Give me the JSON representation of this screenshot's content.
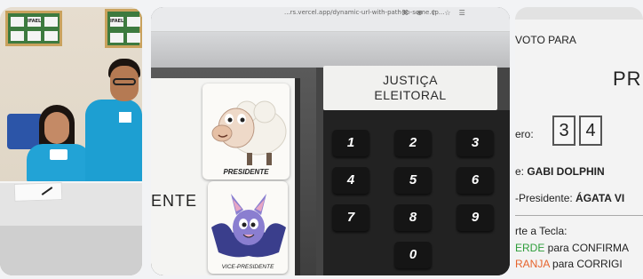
{
  "photo": {
    "board_labels": [
      "IFAEL",
      "IFAEL"
    ]
  },
  "browser": {
    "url_text": "...rs.vercel.app/dynamic-url-with-path-to-some.cp...",
    "icons": [
      "extension-icon",
      "zoom-icon",
      "share-icon",
      "star-icon",
      "menu-icon"
    ]
  },
  "machine": {
    "screen_label": "ENTE",
    "card_president_caption": "PRESIDENTE",
    "card_vice_caption": "VICE-PRESIDENTE",
    "title_line1": "JUSTIÇA",
    "title_line2": "ELEITORAL",
    "keys": [
      "1",
      "2",
      "3",
      "4",
      "5",
      "6",
      "7",
      "8",
      "9",
      "0"
    ]
  },
  "confirm": {
    "voto_para": "VOTO PARA",
    "office": "PRE",
    "numero_label": "ero:",
    "digits": [
      "3",
      "4"
    ],
    "name_label": "e: ",
    "name_value": "GABI DOLPHIN",
    "vice_label": "-Presidente: ",
    "vice_value": "ÁGATA VI",
    "tecla": "rte a Tecla:",
    "confirm_color_word": "ERDE",
    "confirm_rest": " para CONFIRMA",
    "correct_color_word": "RANJA",
    "correct_rest": " para CORRIGI"
  },
  "colors": {
    "confirm_green": "#2d9d3a",
    "correct_orange": "#e6632c",
    "uniform_blue": "#1d9fd2"
  }
}
